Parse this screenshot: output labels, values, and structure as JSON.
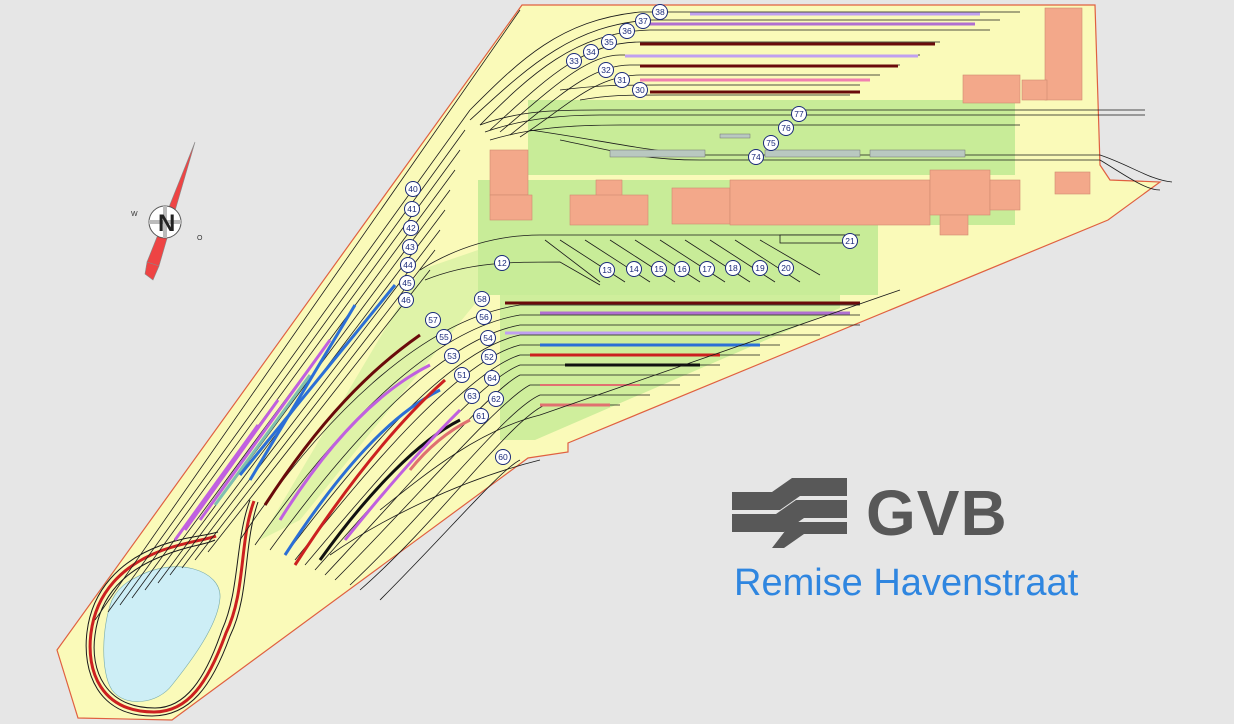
{
  "map": {
    "colors": {
      "background": "#e6e6e6",
      "yard": "#fafab9",
      "yard_border": "#e06040",
      "green_area": "#c8ec98",
      "buildings": "#f3a88a",
      "pond": "#cdeef6",
      "track": "#1a1a1a",
      "label_stroke": "#1a2a7a"
    },
    "track_labels": [
      "38",
      "37",
      "36",
      "35",
      "34",
      "33",
      "32",
      "31",
      "30",
      "77",
      "76",
      "75",
      "74",
      "40",
      "41",
      "42",
      "43",
      "44",
      "45",
      "46",
      "21",
      "12",
      "13",
      "14",
      "15",
      "16",
      "17",
      "18",
      "19",
      "20",
      "58",
      "57",
      "56",
      "55",
      "54",
      "53",
      "52",
      "51",
      "64",
      "63",
      "62",
      "61",
      "60"
    ],
    "parked_car_colors": [
      "#6a0a0a",
      "#c060e0",
      "#2b6fd6",
      "#111111",
      "#e07070",
      "#cc2020"
    ]
  },
  "compass": {
    "letter": "N",
    "west_label": "W",
    "east_label": "O"
  },
  "brand": {
    "logo_text": "GVB",
    "subtitle": "Remise Havenstraat",
    "logo_color": "#585858",
    "subtitle_color": "#2f86e0"
  }
}
